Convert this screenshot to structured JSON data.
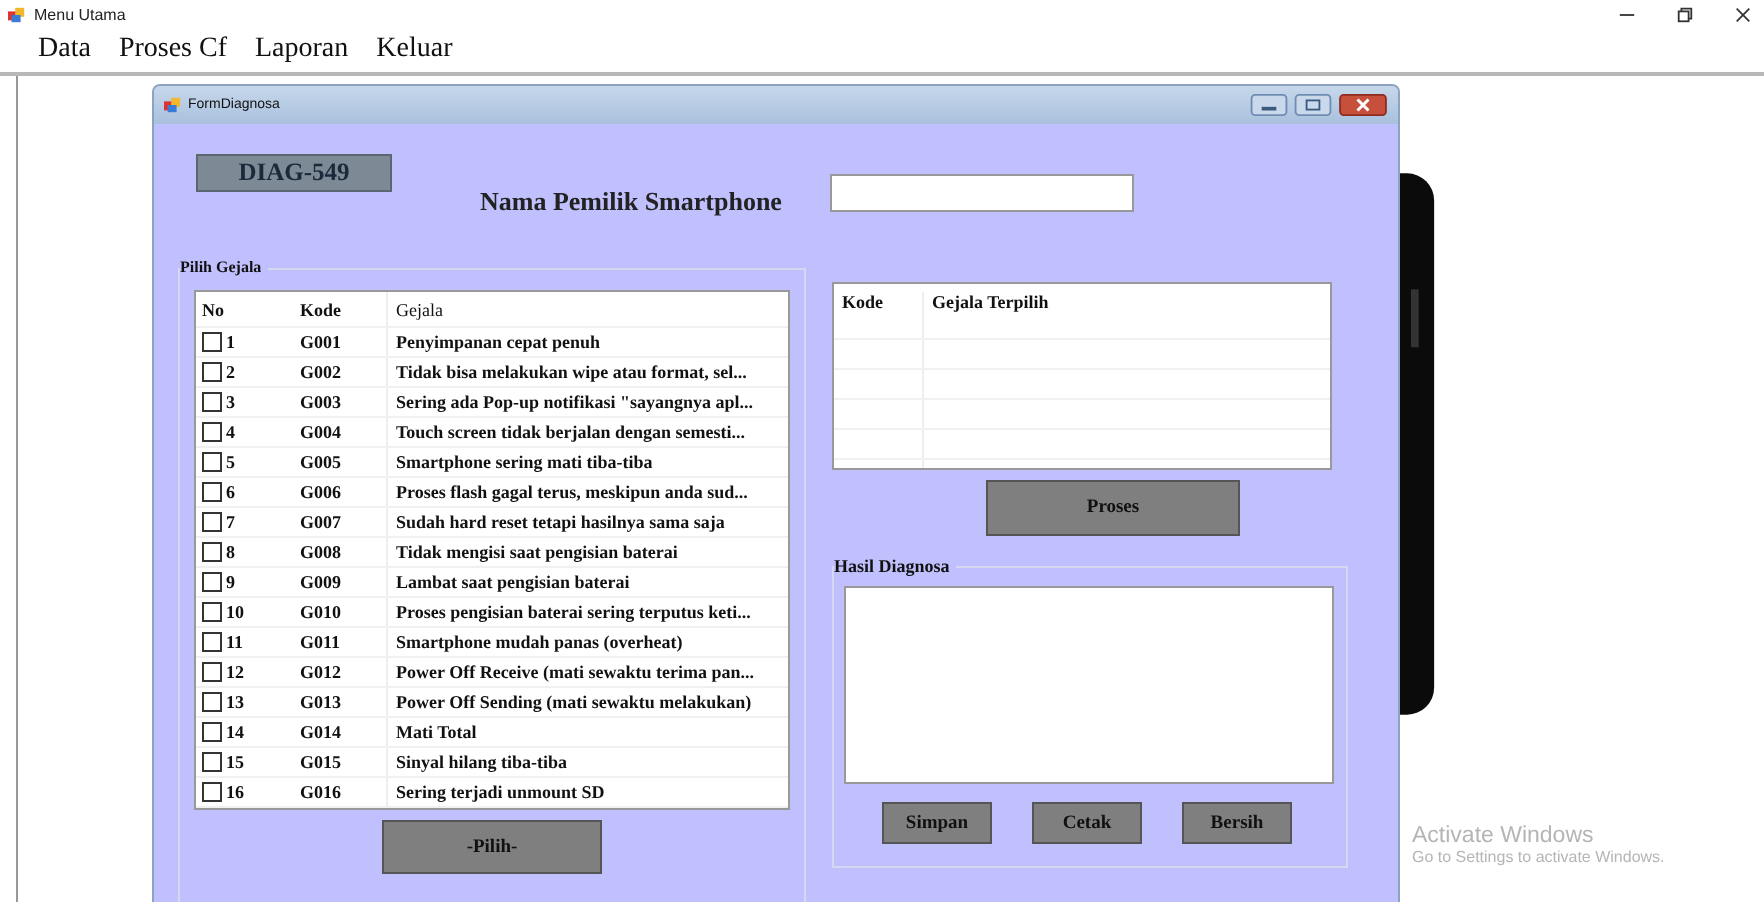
{
  "window": {
    "title": "Menu Utama"
  },
  "menu": [
    "Data",
    "Proses Cf",
    "Laporan",
    "Keluar"
  ],
  "form": {
    "title": "FormDiagnosa",
    "code": "DIAG-549",
    "owner_label": "Nama Pemilik Smartphone",
    "symptoms": {
      "title": "Pilih Gejala",
      "columns": [
        "No",
        "Kode",
        "Gejala"
      ],
      "rows": [
        {
          "no": "1",
          "code": "G001",
          "text": "Penyimpanan cepat penuh",
          "checked": false
        },
        {
          "no": "2",
          "code": "G002",
          "text": "Tidak bisa melakukan wipe atau format, sel...",
          "checked": false
        },
        {
          "no": "3",
          "code": "G003",
          "text": "Sering ada Pop-up notifikasi \"sayangnya apl...",
          "checked": false
        },
        {
          "no": "4",
          "code": "G004",
          "text": "Touch screen tidak berjalan dengan semesti...",
          "checked": false
        },
        {
          "no": "5",
          "code": "G005",
          "text": "Smartphone sering mati tiba-tiba",
          "checked": false
        },
        {
          "no": "6",
          "code": "G006",
          "text": "Proses flash gagal terus, meskipun anda sud...",
          "checked": false
        },
        {
          "no": "7",
          "code": "G007",
          "text": "Sudah hard reset tetapi hasilnya sama saja",
          "checked": false
        },
        {
          "no": "8",
          "code": "G008",
          "text": "Tidak mengisi saat pengisian baterai",
          "checked": false
        },
        {
          "no": "9",
          "code": "G009",
          "text": "Lambat saat pengisian baterai",
          "checked": false
        },
        {
          "no": "10",
          "code": "G010",
          "text": "Proses pengisian baterai sering terputus keti...",
          "checked": false
        },
        {
          "no": "11",
          "code": "G011",
          "text": "Smartphone mudah panas (overheat)",
          "checked": false
        },
        {
          "no": "12",
          "code": "G012",
          "text": "Power Off Receive (mati sewaktu terima pan...",
          "checked": false
        },
        {
          "no": "13",
          "code": "G013",
          "text": "Power Off Sending (mati sewaktu melakukan)",
          "checked": false
        },
        {
          "no": "14",
          "code": "G014",
          "text": "Mati Total",
          "checked": false
        },
        {
          "no": "15",
          "code": "G015",
          "text": "Sinyal hilang tiba-tiba",
          "checked": false
        },
        {
          "no": "16",
          "code": "G016",
          "text": "Sering terjadi unmount SD",
          "checked": false
        }
      ],
      "button": "-Pilih-"
    },
    "selected_table": {
      "columns": [
        "Kode",
        "Gejala Terpilih"
      ]
    },
    "process_button": "Proses",
    "result": {
      "title": "Hasil Diagnosa",
      "buttons": [
        "Simpan",
        "Cetak",
        "Bersih"
      ]
    }
  },
  "activation_notice": {
    "title": "Activate Windows",
    "text": "Go to Settings to activate Windows."
  }
}
